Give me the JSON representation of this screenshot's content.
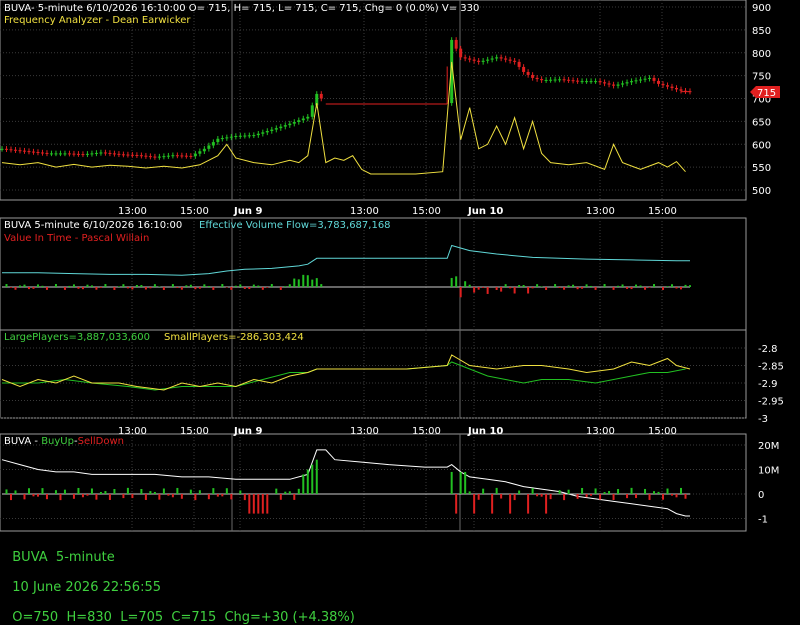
{
  "colors": {
    "background": "#000000",
    "grid": "#3a3a3a",
    "frame": "#9a9a9a",
    "up": "#22c022",
    "down": "#e02020",
    "yellow": "#f0e040",
    "cyan": "#60d8d8",
    "white": "#ffffff",
    "price_marker": "#e02020"
  },
  "panels": {
    "price": {
      "header": "BUVA- 5-minute 6/10/2026 16:10:00 O= 715, H= 715, L= 715, C= 715, Chg= 0 (0.0%) V= 330",
      "indicator_name": "Frequency Analyzer - Dean Earwicker",
      "price_marker": "715"
    },
    "flow": {
      "header_symbol": "BUVA 5-minute  6/10/2026 16:10:00",
      "header_value": "Effective Volume Flow=3,783,687,168",
      "indicator_name": "Value In Time - Pascal Willain"
    },
    "players": {
      "large_label": "LargePlayers=3,887,033,600",
      "small_label": "SmallPlayers=-286,303,424"
    },
    "buysell": {
      "symbol": "BUVA - ",
      "buy_label": "BuyUp",
      "sep": "-",
      "sell_label": "SellDown"
    }
  },
  "time_axis": [
    "13:00",
    "15:00",
    "Jun 9",
    "13:00",
    "15:00",
    "Jun 10",
    "13:00",
    "15:00"
  ],
  "status_bar": {
    "symbol": "BUVA  5-minute",
    "datetime": "10 June 2026 22:56:55",
    "ohlc": "O=750  H=830  L=705  C=715  Chg=+30 (+4.38%)"
  },
  "chart_data": [
    {
      "type": "candlestick",
      "title": "BUVA- 5-minute",
      "y_ticks": [
        900,
        850,
        800,
        750,
        700,
        650,
        600,
        550,
        500
      ],
      "ylim": [
        480,
        905
      ],
      "x_index_range": [
        0,
        130
      ],
      "price_series": [
        [
          0,
          590
        ],
        [
          5,
          585
        ],
        [
          10,
          580
        ],
        [
          14,
          580
        ],
        [
          18,
          578
        ],
        [
          22,
          582
        ],
        [
          26,
          578
        ],
        [
          30,
          576
        ],
        [
          34,
          572
        ],
        [
          38,
          576
        ],
        [
          42,
          574
        ],
        [
          45,
          590
        ],
        [
          48,
          612
        ],
        [
          52,
          618
        ],
        [
          56,
          620
        ],
        [
          60,
          632
        ],
        [
          64,
          645
        ],
        [
          68,
          660
        ],
        [
          70,
          710
        ],
        [
          72,
          690
        ],
        [
          76,
          688
        ],
        [
          80,
          688
        ],
        [
          86,
          688
        ],
        [
          92,
          688
        ],
        [
          97,
          688
        ],
        [
          99,
          690
        ],
        [
          100,
          828
        ],
        [
          102,
          790
        ],
        [
          106,
          780
        ],
        [
          110,
          790
        ],
        [
          114,
          780
        ],
        [
          116,
          758
        ],
        [
          118,
          745
        ],
        [
          120,
          740
        ],
        [
          124,
          742
        ],
        [
          128,
          738
        ],
        [
          132,
          738
        ],
        [
          136,
          728
        ],
        [
          140,
          738
        ],
        [
          144,
          745
        ],
        [
          146,
          732
        ],
        [
          148,
          726
        ],
        [
          151,
          717
        ],
        [
          153,
          715
        ]
      ],
      "cycle_series": [
        [
          0,
          560
        ],
        [
          4,
          555
        ],
        [
          8,
          560
        ],
        [
          12,
          550
        ],
        [
          16,
          556
        ],
        [
          20,
          550
        ],
        [
          24,
          554
        ],
        [
          28,
          552
        ],
        [
          32,
          548
        ],
        [
          36,
          552
        ],
        [
          40,
          548
        ],
        [
          44,
          555
        ],
        [
          48,
          575
        ],
        [
          50,
          600
        ],
        [
          52,
          570
        ],
        [
          56,
          560
        ],
        [
          60,
          555
        ],
        [
          64,
          565
        ],
        [
          66,
          560
        ],
        [
          68,
          575
        ],
        [
          70,
          690
        ],
        [
          72,
          560
        ],
        [
          74,
          570
        ],
        [
          76,
          565
        ],
        [
          78,
          575
        ],
        [
          80,
          545
        ],
        [
          82,
          535
        ],
        [
          86,
          535
        ],
        [
          92,
          535
        ],
        [
          98,
          540
        ],
        [
          100,
          780
        ],
        [
          102,
          610
        ],
        [
          104,
          680
        ],
        [
          106,
          590
        ],
        [
          108,
          600
        ],
        [
          110,
          640
        ],
        [
          112,
          600
        ],
        [
          114,
          658
        ],
        [
          116,
          590
        ],
        [
          118,
          650
        ],
        [
          120,
          580
        ],
        [
          122,
          560
        ],
        [
          126,
          555
        ],
        [
          130,
          560
        ],
        [
          134,
          545
        ],
        [
          136,
          600
        ],
        [
          138,
          560
        ],
        [
          142,
          545
        ],
        [
          146,
          560
        ],
        [
          148,
          550
        ],
        [
          150,
          562
        ],
        [
          152,
          540
        ]
      ]
    },
    {
      "type": "line",
      "title": "Effective Volume Flow",
      "series": [
        {
          "name": "Effective Volume Flow",
          "values": [
            [
              0,
              58
            ],
            [
              8,
              58
            ],
            [
              16,
              57
            ],
            [
              24,
              56
            ],
            [
              32,
              56
            ],
            [
              40,
              55
            ],
            [
              46,
              57
            ],
            [
              50,
              60
            ],
            [
              54,
              62
            ],
            [
              60,
              63
            ],
            [
              66,
              66
            ],
            [
              68,
              68
            ],
            [
              70,
              75
            ],
            [
              76,
              75
            ],
            [
              86,
              75
            ],
            [
              99,
              75
            ],
            [
              100,
              90
            ],
            [
              104,
              84
            ],
            [
              110,
              80
            ],
            [
              114,
              78
            ],
            [
              118,
              76
            ],
            [
              124,
              75
            ],
            [
              130,
              74
            ],
            [
              140,
              73
            ],
            [
              150,
              72
            ],
            [
              153,
              72
            ]
          ]
        }
      ]
    },
    {
      "type": "line",
      "title": "Players",
      "y_ticks": [
        -2.8,
        -2.85,
        -2.9,
        -2.95,
        -3
      ],
      "ylim": [
        -3.03,
        -2.77
      ],
      "series": [
        {
          "name": "LargePlayers",
          "values": [
            [
              0,
              -2.9
            ],
            [
              8,
              -2.9
            ],
            [
              14,
              -2.89
            ],
            [
              20,
              -2.9
            ],
            [
              28,
              -2.91
            ],
            [
              34,
              -2.92
            ],
            [
              40,
              -2.91
            ],
            [
              46,
              -2.91
            ],
            [
              52,
              -2.91
            ],
            [
              58,
              -2.89
            ],
            [
              64,
              -2.87
            ],
            [
              68,
              -2.87
            ],
            [
              70,
              -2.86
            ],
            [
              80,
              -2.86
            ],
            [
              90,
              -2.86
            ],
            [
              99,
              -2.85
            ],
            [
              100,
              -2.84
            ],
            [
              104,
              -2.86
            ],
            [
              108,
              -2.88
            ],
            [
              112,
              -2.89
            ],
            [
              116,
              -2.9
            ],
            [
              120,
              -2.89
            ],
            [
              126,
              -2.89
            ],
            [
              132,
              -2.9
            ],
            [
              136,
              -2.89
            ],
            [
              140,
              -2.88
            ],
            [
              144,
              -2.87
            ],
            [
              148,
              -2.87
            ],
            [
              152,
              -2.86
            ]
          ]
        },
        {
          "name": "SmallPlayers",
          "values": [
            [
              0,
              -2.89
            ],
            [
              4,
              -2.91
            ],
            [
              8,
              -2.89
            ],
            [
              12,
              -2.9
            ],
            [
              16,
              -2.88
            ],
            [
              20,
              -2.9
            ],
            [
              26,
              -2.9
            ],
            [
              30,
              -2.91
            ],
            [
              36,
              -2.92
            ],
            [
              40,
              -2.9
            ],
            [
              44,
              -2.91
            ],
            [
              48,
              -2.9
            ],
            [
              52,
              -2.91
            ],
            [
              56,
              -2.89
            ],
            [
              60,
              -2.9
            ],
            [
              64,
              -2.88
            ],
            [
              68,
              -2.87
            ],
            [
              70,
              -2.86
            ],
            [
              80,
              -2.86
            ],
            [
              90,
              -2.86
            ],
            [
              99,
              -2.85
            ],
            [
              100,
              -2.82
            ],
            [
              104,
              -2.85
            ],
            [
              110,
              -2.86
            ],
            [
              116,
              -2.85
            ],
            [
              120,
              -2.85
            ],
            [
              126,
              -2.86
            ],
            [
              130,
              -2.87
            ],
            [
              136,
              -2.86
            ],
            [
              140,
              -2.84
            ],
            [
              144,
              -2.85
            ],
            [
              148,
              -2.83
            ],
            [
              150,
              -2.85
            ],
            [
              153,
              -2.86
            ]
          ]
        }
      ]
    },
    {
      "type": "line",
      "title": "BuyUp-SellDown",
      "y_ticks": [
        "20M",
        "10M",
        "0",
        "-1"
      ],
      "series": [
        {
          "name": "BuyUp-SellDown",
          "values": [
            [
              0,
              14
            ],
            [
              4,
              12
            ],
            [
              8,
              10
            ],
            [
              12,
              9
            ],
            [
              16,
              9
            ],
            [
              20,
              8
            ],
            [
              24,
              8
            ],
            [
              28,
              8
            ],
            [
              34,
              8
            ],
            [
              40,
              7
            ],
            [
              46,
              7
            ],
            [
              52,
              6
            ],
            [
              58,
              6
            ],
            [
              64,
              6
            ],
            [
              68,
              8
            ],
            [
              70,
              18
            ],
            [
              72,
              18
            ],
            [
              74,
              14
            ],
            [
              80,
              13
            ],
            [
              86,
              12
            ],
            [
              94,
              11
            ],
            [
              99,
              11
            ],
            [
              100,
              12
            ],
            [
              102,
              9
            ],
            [
              104,
              7
            ],
            [
              108,
              6
            ],
            [
              112,
              5
            ],
            [
              116,
              3
            ],
            [
              120,
              2
            ],
            [
              124,
              1
            ],
            [
              128,
              -1
            ],
            [
              132,
              -2
            ],
            [
              136,
              -3
            ],
            [
              140,
              -4
            ],
            [
              144,
              -5
            ],
            [
              148,
              -6
            ],
            [
              150,
              -8
            ],
            [
              152,
              -9
            ],
            [
              153,
              -9
            ]
          ]
        }
      ]
    }
  ]
}
